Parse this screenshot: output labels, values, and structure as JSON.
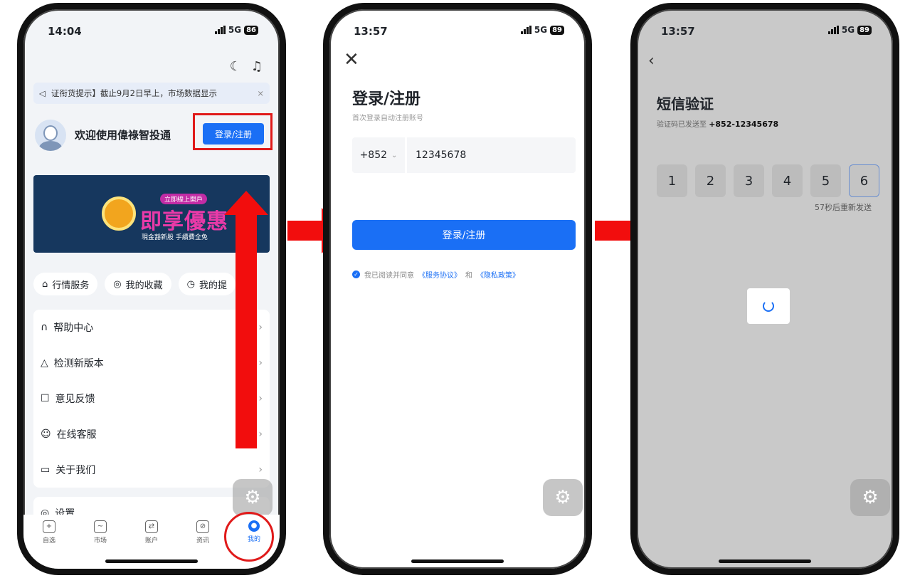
{
  "colors": {
    "accent": "#1a6ff5",
    "highlight": "#e01a1a",
    "arrow": "#f20d0d"
  },
  "phone1": {
    "time": "14:04",
    "network": "5G",
    "battery": "86",
    "notice": "证衔货提示】截止9月2日早上，市场数据显示",
    "notice_close": "×",
    "welcome": "欢迎使用偉祿智投通",
    "login_button": "登录/注册",
    "banner": {
      "tag": "立即線上開戶",
      "title": "即享優惠",
      "subtitle": "現金豁新股  手續費全免"
    },
    "chips": [
      {
        "icon": "bank-icon",
        "label": "行情服务"
      },
      {
        "icon": "favorite-icon",
        "label": "我的收藏"
      },
      {
        "icon": "alarm-icon",
        "label": "我的提"
      }
    ],
    "menu": [
      {
        "icon": "headset-icon",
        "label": "帮助中心"
      },
      {
        "icon": "update-icon",
        "label": "检测新版本"
      },
      {
        "icon": "feedback-icon",
        "label": "意见反馈"
      },
      {
        "icon": "chat-icon",
        "label": "在线客服"
      },
      {
        "icon": "book-icon",
        "label": "关于我们"
      }
    ],
    "settings": "设置",
    "tabs": [
      "自选",
      "市场",
      "账户",
      "资讯",
      "我的"
    ]
  },
  "phone2": {
    "time": "13:57",
    "network": "5G",
    "battery": "89",
    "title": "登录/注册",
    "subtitle": "首次登录自动注册账号",
    "country_code": "+852",
    "phone_number": "12345678",
    "submit": "登录/注册",
    "agree_prefix": "我已阅读并同意",
    "terms": "《服务协议》",
    "and": "和",
    "privacy": "《隐私政策》"
  },
  "phone3": {
    "time": "13:57",
    "network": "5G",
    "battery": "89",
    "title": "短信验证",
    "sent_to_prefix": "验证码已发送至",
    "sent_to_number": "+852-12345678",
    "code": [
      "1",
      "2",
      "3",
      "4",
      "5",
      "6"
    ],
    "resend": "57秒后重新发送"
  }
}
